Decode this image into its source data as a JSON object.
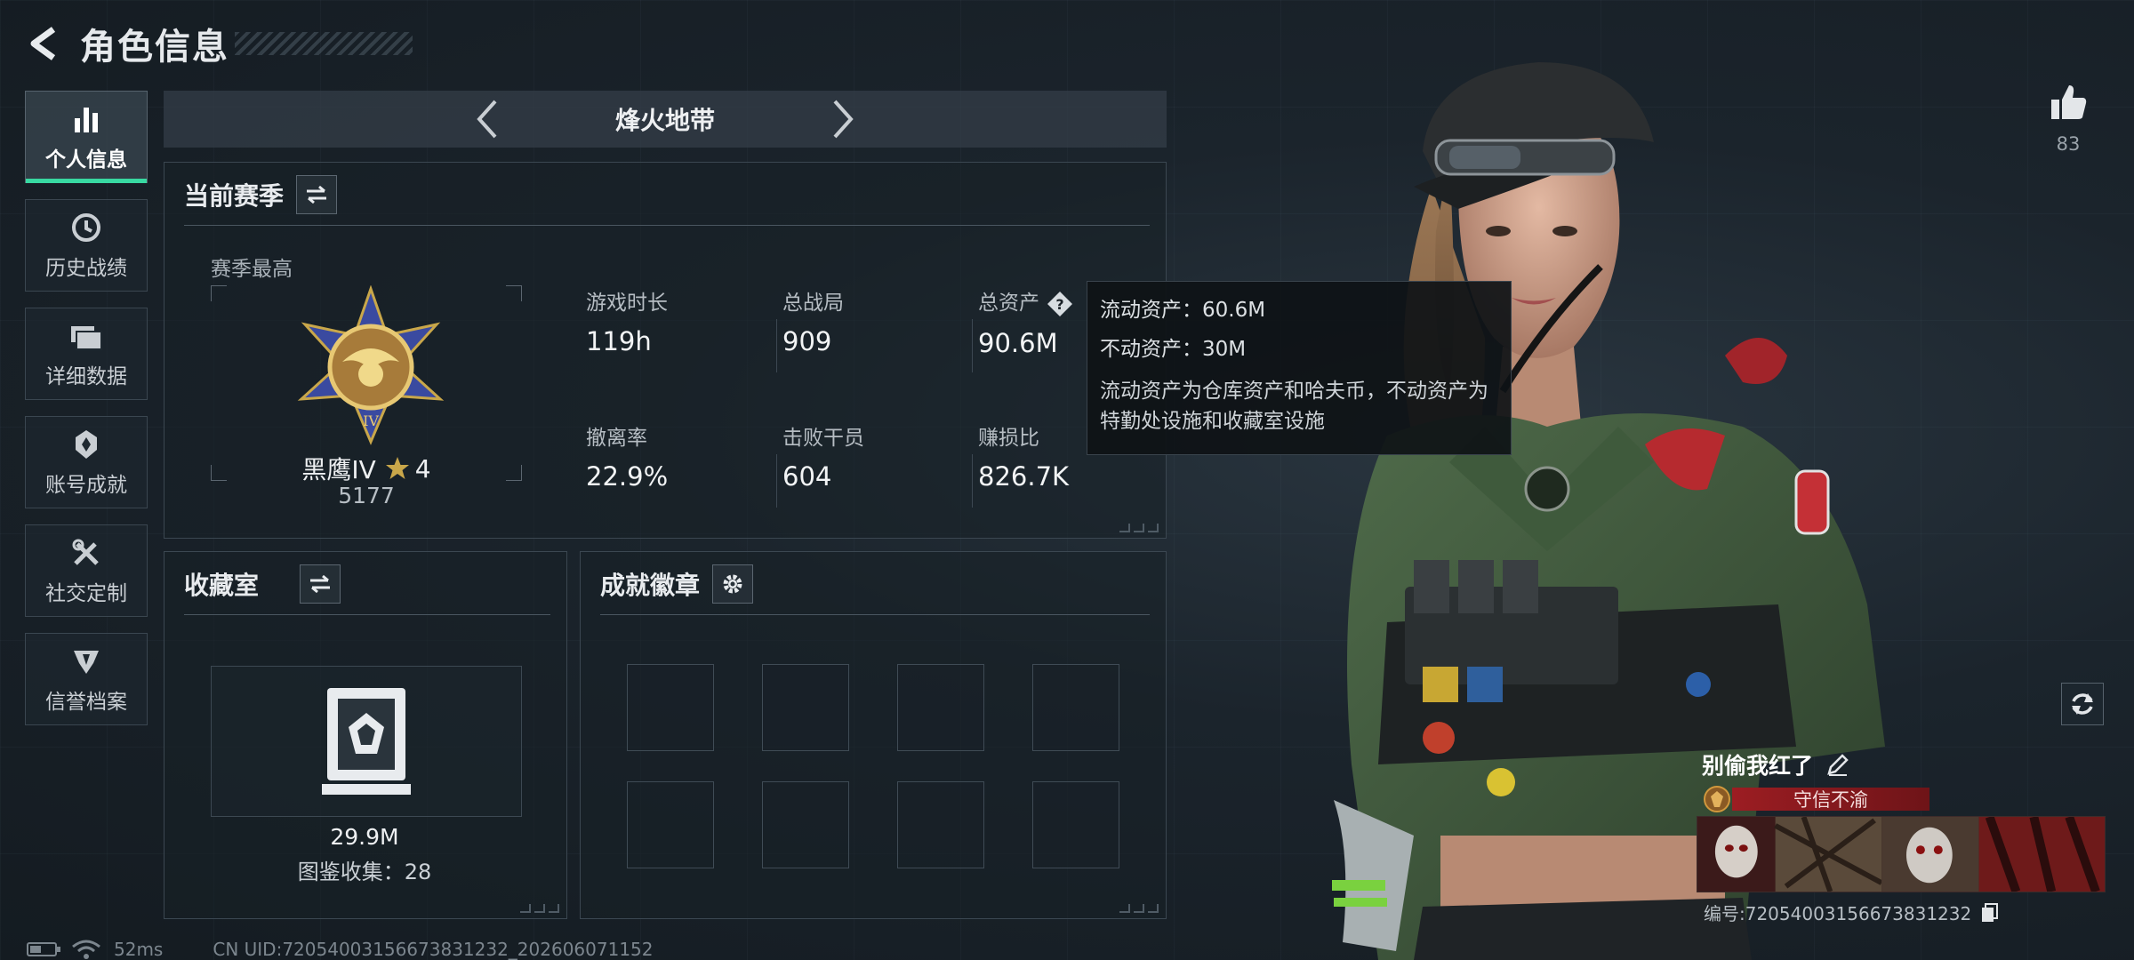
{
  "header": {
    "title": "角色信息"
  },
  "sidebar": {
    "items": [
      {
        "label": "个人信息",
        "icon": "bar-chart-icon",
        "active": true
      },
      {
        "label": "历史战绩",
        "icon": "history-clock-icon"
      },
      {
        "label": "详细数据",
        "icon": "folder-icon"
      },
      {
        "label": "账号成就",
        "icon": "achievement-icon"
      },
      {
        "label": "社交定制",
        "icon": "tools-icon"
      },
      {
        "label": "信誉档案",
        "icon": "reputation-icon"
      }
    ]
  },
  "mode": {
    "name": "烽火地带"
  },
  "season": {
    "title": "当前赛季",
    "best_label": "赛季最高",
    "rank_name": "黑鹰IV",
    "rank_stars": "4",
    "rank_score": "5177",
    "stats": [
      {
        "label": "游戏时长",
        "value": "119h"
      },
      {
        "label": "总战局",
        "value": "909"
      },
      {
        "label": "总资产",
        "value": "90.6M"
      },
      {
        "label": "撤离率",
        "value": "22.9%"
      },
      {
        "label": "击败干员",
        "value": "604"
      },
      {
        "label": "赚损比",
        "value": "826.7K"
      }
    ]
  },
  "tooltip": {
    "liquid": "流动资产：60.6M",
    "fixed": "不动资产：30M",
    "description": "流动资产为仓库资产和哈夫币，不动资产为特勤处设施和收藏室设施"
  },
  "collection": {
    "title": "收藏室",
    "value": "29.9M",
    "count": "图鉴收集：28"
  },
  "achievements": {
    "title": "成就徽章",
    "slots": 8
  },
  "player": {
    "likes": "83",
    "name": "别偷我红了",
    "honor": "守信不渝",
    "id": "编号:72054003156673831232"
  },
  "status": {
    "ping": "52ms",
    "uid": "CN UID:72054003156673831232_202606071152"
  },
  "colors": {
    "accent": "#38d9a2",
    "honor_red": "#9c1d22",
    "panel_border": "#3b4751"
  }
}
